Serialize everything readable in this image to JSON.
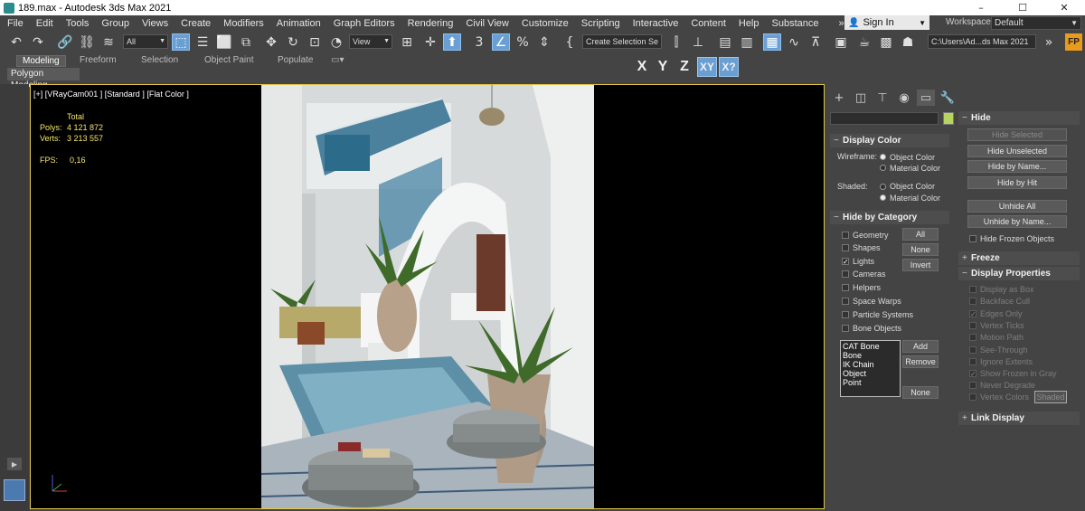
{
  "window": {
    "title": "189.max - Autodesk 3ds Max 2021",
    "controls": [
      "–",
      "☐",
      "✕"
    ]
  },
  "menu": {
    "items": [
      "File",
      "Edit",
      "Tools",
      "Group",
      "Views",
      "Create",
      "Modifiers",
      "Animation",
      "Graph Editors",
      "Rendering",
      "Civil View",
      "Customize",
      "Scripting",
      "Interactive",
      "Content",
      "Help",
      "Substance"
    ],
    "more": "»",
    "sign_in": "Sign In",
    "workspaces_label": "Workspaces:",
    "workspace_value": "Default"
  },
  "toolbar": {
    "filter_value": "All",
    "view_value": "View",
    "selection_set_value": "Create Selection Se",
    "project_path": "C:\\Users\\Ad...ds Max 2021",
    "fp_label": "FP",
    "more": "»"
  },
  "ribbon": {
    "tabs": [
      "Modeling",
      "Freeform",
      "Selection",
      "Object Paint",
      "Populate"
    ],
    "sub_label": "Polygon Modeling",
    "axis_buttons": [
      "X",
      "Y",
      "Z",
      "XY",
      "X?"
    ]
  },
  "viewport": {
    "label": "[+] [VRayCam001 ] [Standard ] [Flat Color ]",
    "stats": {
      "header": "Total",
      "polys_label": "Polys:",
      "polys_value": "4 121 872",
      "verts_label": "Verts:",
      "verts_value": "3 213 557",
      "fps_label": "FPS:",
      "fps_value": "0,16"
    }
  },
  "left_strip": {
    "play_icon": "▶"
  },
  "panel": {
    "hide": {
      "title": "Hide",
      "buttons": [
        "Hide Selected",
        "Hide Unselected",
        "Hide by Name...",
        "Hide by Hit",
        "Unhide All",
        "Unhide by Name..."
      ],
      "frozen": "Hide Frozen Objects"
    },
    "freeze": {
      "title": "Freeze"
    },
    "display_props": {
      "title": "Display Properties",
      "items": [
        "Display as Box",
        "Backface Cull",
        "Edges Only",
        "Vertex Ticks",
        "Motion Path",
        "See-Through",
        "Ignore Extents",
        "Show Frozen in Gray",
        "Never Degrade",
        "Vertex Colors"
      ],
      "shaded_btn": "Shaded"
    },
    "link_display": {
      "title": "Link Display"
    },
    "display_color": {
      "title": "Display Color",
      "wireframe_label": "Wireframe:",
      "shaded_label": "Shaded:",
      "object_color": "Object Color",
      "material_color": "Material Color"
    },
    "hide_by_category": {
      "title": "Hide by Category",
      "categories": [
        "Geometry",
        "Shapes",
        "Lights",
        "Cameras",
        "Helpers",
        "Space Warps",
        "Particle Systems",
        "Bone Objects"
      ],
      "side_buttons": [
        "All",
        "None",
        "Invert"
      ],
      "list": [
        "CAT Bone",
        "Bone",
        "IK Chain Object",
        "Point"
      ],
      "list_buttons": [
        "Add",
        "Remove",
        "None"
      ]
    }
  }
}
